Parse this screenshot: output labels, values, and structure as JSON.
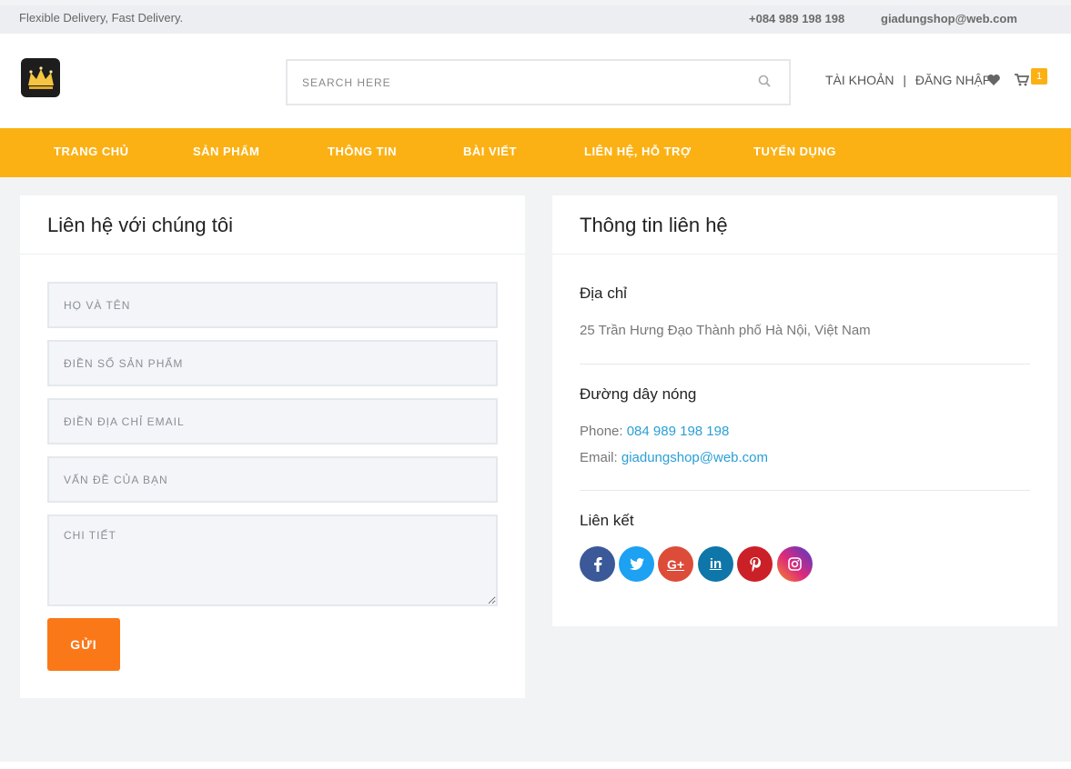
{
  "topbar": {
    "tagline": "Flexible Delivery, Fast Delivery.",
    "phone": "+084 989 198 198",
    "email": "giadungshop@web.com"
  },
  "header": {
    "search_placeholder": "SEARCH HERE",
    "account_label": "TÀI KHOẢN",
    "separator": "|",
    "login_label": "ĐĂNG NHẬP",
    "cart_count": "1"
  },
  "nav": {
    "items": [
      {
        "label": "TRANG CHỦ"
      },
      {
        "label": "SẢN PHẨM"
      },
      {
        "label": "THÔNG TIN"
      },
      {
        "label": "BÀI VIẾT"
      },
      {
        "label": "LIÊN HỆ, HỖ TRỢ"
      },
      {
        "label": "TUYỂN DỤNG"
      }
    ]
  },
  "contact_form": {
    "title": "Liên hệ với chúng tôi",
    "fields": {
      "name": "HỌ VÀ TÊN",
      "phone": "ĐIỀN SỐ SẢN PHẨM",
      "email": "ĐIỀN ĐỊA CHỈ EMAIL",
      "subject": "VẤN ĐỀ CỦA BẠN",
      "details": "CHI TIẾT"
    },
    "submit_label": "GỬI"
  },
  "contact_info": {
    "title": "Thông tin liên hệ",
    "address_heading": "Địa chỉ",
    "address": "25 Trần Hưng Đạo Thành phố Hà Nội, Việt Nam",
    "hotline_heading": "Đường dây nóng",
    "phone_label": "Phone:",
    "phone_value": "084 989 198 198",
    "email_label": "Email:",
    "email_value": "giadungshop@web.com",
    "links_heading": "Liên kết",
    "social": [
      {
        "name": "facebook-icon",
        "glyph": "f",
        "color": "#3b5998"
      },
      {
        "name": "twitter-icon",
        "glyph": "t",
        "color": "#1da1f2"
      },
      {
        "name": "google-plus-icon",
        "glyph": "G+",
        "color": "#dd4b39"
      },
      {
        "name": "linkedin-icon",
        "glyph": "in",
        "color": "#0e76a8"
      },
      {
        "name": "pinterest-icon",
        "glyph": "P",
        "color": "#cb2027"
      },
      {
        "name": "instagram-icon",
        "glyph": "◎",
        "color": "#c13584"
      }
    ]
  },
  "colors": {
    "accent": "#fbb114",
    "button": "#fb7818",
    "link": "#2a9fd6"
  }
}
